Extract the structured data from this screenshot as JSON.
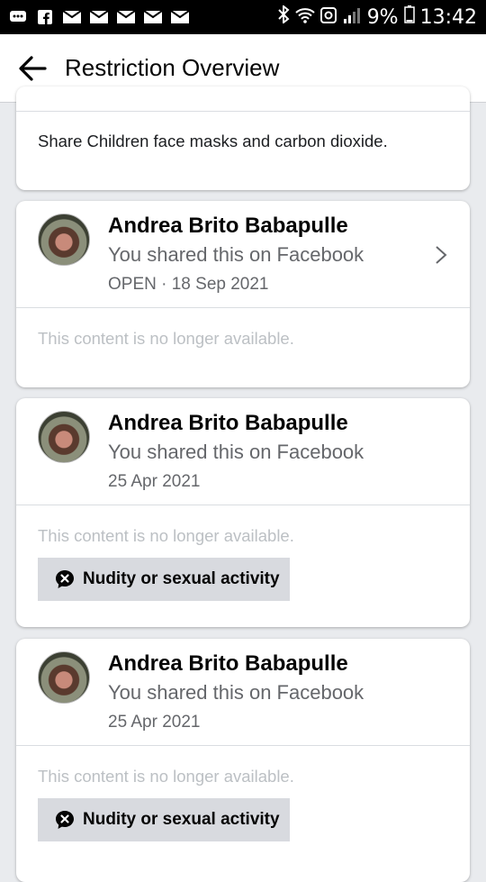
{
  "status_bar": {
    "battery": "9%",
    "time": "13:42"
  },
  "header": {
    "title": "Restriction Overview"
  },
  "partial_card": {
    "text": "Share Children face masks and carbon dioxide."
  },
  "posts": [
    {
      "author": "Andrea Brito Babapulle",
      "shared": "You shared this on Facebook",
      "meta": "OPEN · 18 Sep 2021",
      "unavailable": "This content is no longer available."
    },
    {
      "author": "Andrea Brito Babapulle",
      "shared": "You shared this on Facebook",
      "meta": "25 Apr 2021",
      "unavailable": "This content is no longer available.",
      "badge": "Nudity or sexual activity"
    },
    {
      "author": "Andrea Brito Babapulle",
      "shared": "You shared this on Facebook",
      "meta": "25 Apr 2021",
      "unavailable": "This content is no longer available.",
      "badge": "Nudity or sexual activity"
    }
  ],
  "colors": {
    "background": "#e9ebee",
    "card": "#ffffff",
    "badge": "#d8dadf",
    "muted_text": "#65676b",
    "disabled_text": "#bcc0c4"
  }
}
